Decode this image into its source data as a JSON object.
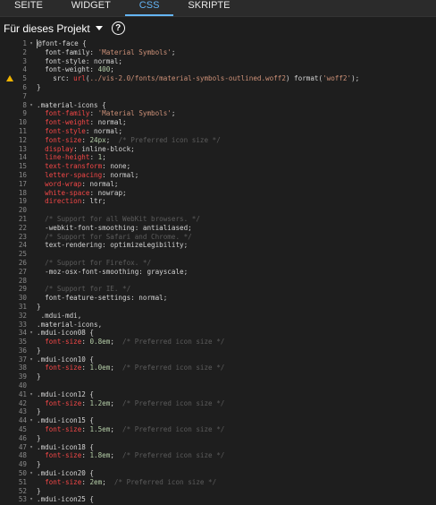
{
  "tabs": [
    {
      "label": "SEITE",
      "active": false
    },
    {
      "label": "WIDGET",
      "active": false
    },
    {
      "label": "CSS",
      "active": true
    },
    {
      "label": "SKRIPTE",
      "active": false
    }
  ],
  "scope": {
    "label": "Für dieses Projekt",
    "help_symbol": "?"
  },
  "colors": {
    "accent": "#64b5f6",
    "warning": "#f0b400",
    "error_token": "#f44747",
    "string": "#ce9178",
    "number": "#b5cea8",
    "comment": "#5c5c5c"
  },
  "editor": {
    "lines": [
      {
        "n": "1",
        "fold": "open",
        "cursor": true,
        "tokens": [
          [
            "t",
            "@font-face {"
          ]
        ]
      },
      {
        "n": "2",
        "tokens": [
          [
            "t",
            "  font-family: "
          ],
          [
            "s",
            "'Material Symbols'"
          ],
          [
            "t",
            ";"
          ]
        ]
      },
      {
        "n": "3",
        "tokens": [
          [
            "t",
            "  font-style: normal;"
          ]
        ]
      },
      {
        "n": "4",
        "tokens": [
          [
            "t",
            "  font-weight: "
          ],
          [
            "n",
            "400"
          ],
          [
            "t",
            ";"
          ]
        ]
      },
      {
        "n": "5",
        "warn": true,
        "tokens": [
          [
            "t",
            "    src: "
          ],
          [
            "r",
            "url"
          ],
          [
            "t",
            "("
          ],
          [
            "s",
            "../vis-2.0/fonts/material-symbols-outlined.woff2"
          ],
          [
            "t",
            ") format("
          ],
          [
            "s",
            "'woff2'"
          ],
          [
            "t",
            ");"
          ]
        ]
      },
      {
        "n": "6",
        "tokens": [
          [
            "t",
            "}"
          ]
        ]
      },
      {
        "n": "7",
        "tokens": []
      },
      {
        "n": "8",
        "fold": "open",
        "tokens": [
          [
            "t",
            ".material-icons {"
          ]
        ]
      },
      {
        "n": "9",
        "tokens": [
          [
            "t",
            "  "
          ],
          [
            "r",
            "font-family"
          ],
          [
            "t",
            ": "
          ],
          [
            "s",
            "'Material Symbols'"
          ],
          [
            "t",
            ";"
          ]
        ]
      },
      {
        "n": "10",
        "tokens": [
          [
            "t",
            "  "
          ],
          [
            "r",
            "font-weight"
          ],
          [
            "t",
            ": normal;"
          ]
        ]
      },
      {
        "n": "11",
        "tokens": [
          [
            "t",
            "  "
          ],
          [
            "r",
            "font-style"
          ],
          [
            "t",
            ": normal;"
          ]
        ]
      },
      {
        "n": "12",
        "tokens": [
          [
            "t",
            "  "
          ],
          [
            "r",
            "font-size"
          ],
          [
            "t",
            ": "
          ],
          [
            "n",
            "24px"
          ],
          [
            "t",
            ";  "
          ],
          [
            "c",
            "/* Preferred icon size */"
          ]
        ]
      },
      {
        "n": "13",
        "tokens": [
          [
            "t",
            "  "
          ],
          [
            "r",
            "display"
          ],
          [
            "t",
            ": inline-block;"
          ]
        ]
      },
      {
        "n": "14",
        "tokens": [
          [
            "t",
            "  "
          ],
          [
            "r",
            "line-height"
          ],
          [
            "t",
            ": "
          ],
          [
            "n",
            "1"
          ],
          [
            "t",
            ";"
          ]
        ]
      },
      {
        "n": "15",
        "tokens": [
          [
            "t",
            "  "
          ],
          [
            "r",
            "text-transform"
          ],
          [
            "t",
            ": none;"
          ]
        ]
      },
      {
        "n": "16",
        "tokens": [
          [
            "t",
            "  "
          ],
          [
            "r",
            "letter-spacing"
          ],
          [
            "t",
            ": normal;"
          ]
        ]
      },
      {
        "n": "17",
        "tokens": [
          [
            "t",
            "  "
          ],
          [
            "r",
            "word-wrap"
          ],
          [
            "t",
            ": normal;"
          ]
        ]
      },
      {
        "n": "18",
        "tokens": [
          [
            "t",
            "  "
          ],
          [
            "r",
            "white-space"
          ],
          [
            "t",
            ": nowrap;"
          ]
        ]
      },
      {
        "n": "19",
        "tokens": [
          [
            "t",
            "  "
          ],
          [
            "r",
            "direction"
          ],
          [
            "t",
            ": ltr;"
          ]
        ]
      },
      {
        "n": "20",
        "tokens": []
      },
      {
        "n": "21",
        "tokens": [
          [
            "t",
            "  "
          ],
          [
            "c",
            "/* Support for all WebKit browsers. */"
          ]
        ]
      },
      {
        "n": "22",
        "tokens": [
          [
            "t",
            "  -webkit-font-smoothing: antialiased;"
          ]
        ]
      },
      {
        "n": "23",
        "tokens": [
          [
            "t",
            "  "
          ],
          [
            "c",
            "/* Support for Safari and Chrome. */"
          ]
        ]
      },
      {
        "n": "24",
        "tokens": [
          [
            "t",
            "  text-rendering: optimizeLegibility;"
          ]
        ]
      },
      {
        "n": "25",
        "tokens": []
      },
      {
        "n": "26",
        "tokens": [
          [
            "t",
            "  "
          ],
          [
            "c",
            "/* Support for Firefox. */"
          ]
        ]
      },
      {
        "n": "27",
        "tokens": [
          [
            "t",
            "  -moz-osx-font-smoothing: grayscale;"
          ]
        ]
      },
      {
        "n": "28",
        "tokens": []
      },
      {
        "n": "29",
        "tokens": [
          [
            "t",
            "  "
          ],
          [
            "c",
            "/* Support for IE. */"
          ]
        ]
      },
      {
        "n": "30",
        "tokens": [
          [
            "t",
            "  font-feature-settings: normal;"
          ]
        ]
      },
      {
        "n": "31",
        "tokens": [
          [
            "t",
            "}"
          ]
        ]
      },
      {
        "n": "32",
        "tokens": [
          [
            "t",
            " .mdui-mdi,"
          ]
        ]
      },
      {
        "n": "33",
        "tokens": [
          [
            "t",
            ".material-icons,"
          ]
        ]
      },
      {
        "n": "34",
        "fold": "open",
        "tokens": [
          [
            "t",
            ".mdui-icon08 {"
          ]
        ]
      },
      {
        "n": "35",
        "tokens": [
          [
            "t",
            "  "
          ],
          [
            "r",
            "font-size"
          ],
          [
            "t",
            ": "
          ],
          [
            "n",
            "0.8em"
          ],
          [
            "t",
            ";  "
          ],
          [
            "c",
            "/* Preferred icon size */"
          ]
        ]
      },
      {
        "n": "36",
        "tokens": [
          [
            "t",
            "}"
          ]
        ]
      },
      {
        "n": "37",
        "fold": "open",
        "tokens": [
          [
            "t",
            ".mdui-icon10 {"
          ]
        ]
      },
      {
        "n": "38",
        "tokens": [
          [
            "t",
            "  "
          ],
          [
            "r",
            "font-size"
          ],
          [
            "t",
            ": "
          ],
          [
            "n",
            "1.0em"
          ],
          [
            "t",
            ";  "
          ],
          [
            "c",
            "/* Preferred icon size */"
          ]
        ]
      },
      {
        "n": "39",
        "tokens": [
          [
            "t",
            "}"
          ]
        ]
      },
      {
        "n": "40",
        "tokens": []
      },
      {
        "n": "41",
        "fold": "open",
        "tokens": [
          [
            "t",
            ".mdui-icon12 {"
          ]
        ]
      },
      {
        "n": "42",
        "tokens": [
          [
            "t",
            "  "
          ],
          [
            "r",
            "font-size"
          ],
          [
            "t",
            ": "
          ],
          [
            "n",
            "1.2em"
          ],
          [
            "t",
            ";  "
          ],
          [
            "c",
            "/* Preferred icon size */"
          ]
        ]
      },
      {
        "n": "43",
        "tokens": [
          [
            "t",
            "}"
          ]
        ]
      },
      {
        "n": "44",
        "fold": "open",
        "tokens": [
          [
            "t",
            ".mdui-icon15 {"
          ]
        ]
      },
      {
        "n": "45",
        "tokens": [
          [
            "t",
            "  "
          ],
          [
            "r",
            "font-size"
          ],
          [
            "t",
            ": "
          ],
          [
            "n",
            "1.5em"
          ],
          [
            "t",
            ";  "
          ],
          [
            "c",
            "/* Preferred icon size */"
          ]
        ]
      },
      {
        "n": "46",
        "tokens": [
          [
            "t",
            "}"
          ]
        ]
      },
      {
        "n": "47",
        "fold": "open",
        "tokens": [
          [
            "t",
            ".mdui-icon18 {"
          ]
        ]
      },
      {
        "n": "48",
        "tokens": [
          [
            "t",
            "  "
          ],
          [
            "r",
            "font-size"
          ],
          [
            "t",
            ": "
          ],
          [
            "n",
            "1.8em"
          ],
          [
            "t",
            ";  "
          ],
          [
            "c",
            "/* Preferred icon size */"
          ]
        ]
      },
      {
        "n": "49",
        "tokens": [
          [
            "t",
            "}"
          ]
        ]
      },
      {
        "n": "50",
        "fold": "open",
        "tokens": [
          [
            "t",
            ".mdui-icon20 {"
          ]
        ]
      },
      {
        "n": "51",
        "tokens": [
          [
            "t",
            "  "
          ],
          [
            "r",
            "font-size"
          ],
          [
            "t",
            ": "
          ],
          [
            "n",
            "2em"
          ],
          [
            "t",
            ";  "
          ],
          [
            "c",
            "/* Preferred icon size */"
          ]
        ]
      },
      {
        "n": "52",
        "tokens": [
          [
            "t",
            "}"
          ]
        ]
      },
      {
        "n": "53",
        "fold": "open",
        "tokens": [
          [
            "t",
            ".mdui-icon25 {"
          ]
        ]
      }
    ]
  }
}
